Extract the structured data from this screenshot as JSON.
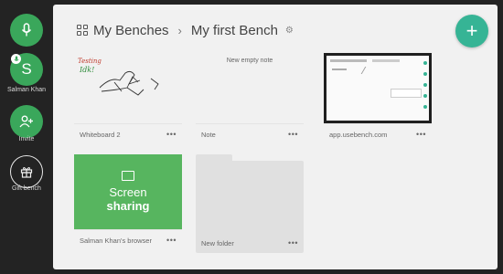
{
  "rail": {
    "user_initial": "S",
    "user_name": "Salman Khan",
    "invite_label": "Invite",
    "gift_label": "Gift bench"
  },
  "header": {
    "breadcrumb_root": "My Benches",
    "separator": "›",
    "breadcrumb_current": "My first Bench",
    "add_label": "+"
  },
  "cards": [
    {
      "name": "Whiteboard 2",
      "type": "whiteboard",
      "more": "•••"
    },
    {
      "name": "Note",
      "type": "note",
      "body_text": "New empty note",
      "more": "•••"
    },
    {
      "name": "app.usebench.com",
      "type": "website",
      "more": "•••"
    },
    {
      "name": "Salman Khan's browser",
      "type": "screen-share",
      "line1": "Screen",
      "line2": "sharing",
      "more": "•••"
    },
    {
      "name": "New folder",
      "type": "folder",
      "more": "•••"
    }
  ],
  "whiteboard_text": [
    "Testing",
    "Idk!"
  ],
  "colors": {
    "accent_green": "#3aa75b",
    "fab_teal": "#36b495",
    "screen_share_green": "#57b55f",
    "panel_bg": "#f1f1f1",
    "rail_bg": "#232323"
  }
}
